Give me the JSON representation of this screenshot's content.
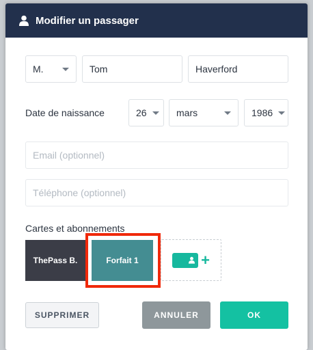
{
  "dialog": {
    "title": "Modifier un passager",
    "icon": "user-icon"
  },
  "form": {
    "civility": "M.",
    "first_name": "Tom",
    "last_name": "Haverford",
    "birthdate_label": "Date de naissance",
    "birth_day": "26",
    "birth_month": "mars",
    "birth_year": "1986",
    "email_placeholder": "Email (optionnel)",
    "phone_placeholder": "Téléphone (optionnel)"
  },
  "cards": {
    "section_label": "Cartes et abonnements",
    "items": [
      "ThePass B.",
      "Forfait 1"
    ],
    "add_icon": "add-card-icon"
  },
  "buttons": {
    "delete": "SUPPRIMER",
    "cancel": "ANNULER",
    "ok": "OK"
  },
  "colors": {
    "header": "#22304c",
    "teal": "#14c1a2",
    "highlight": "#f0290a"
  }
}
